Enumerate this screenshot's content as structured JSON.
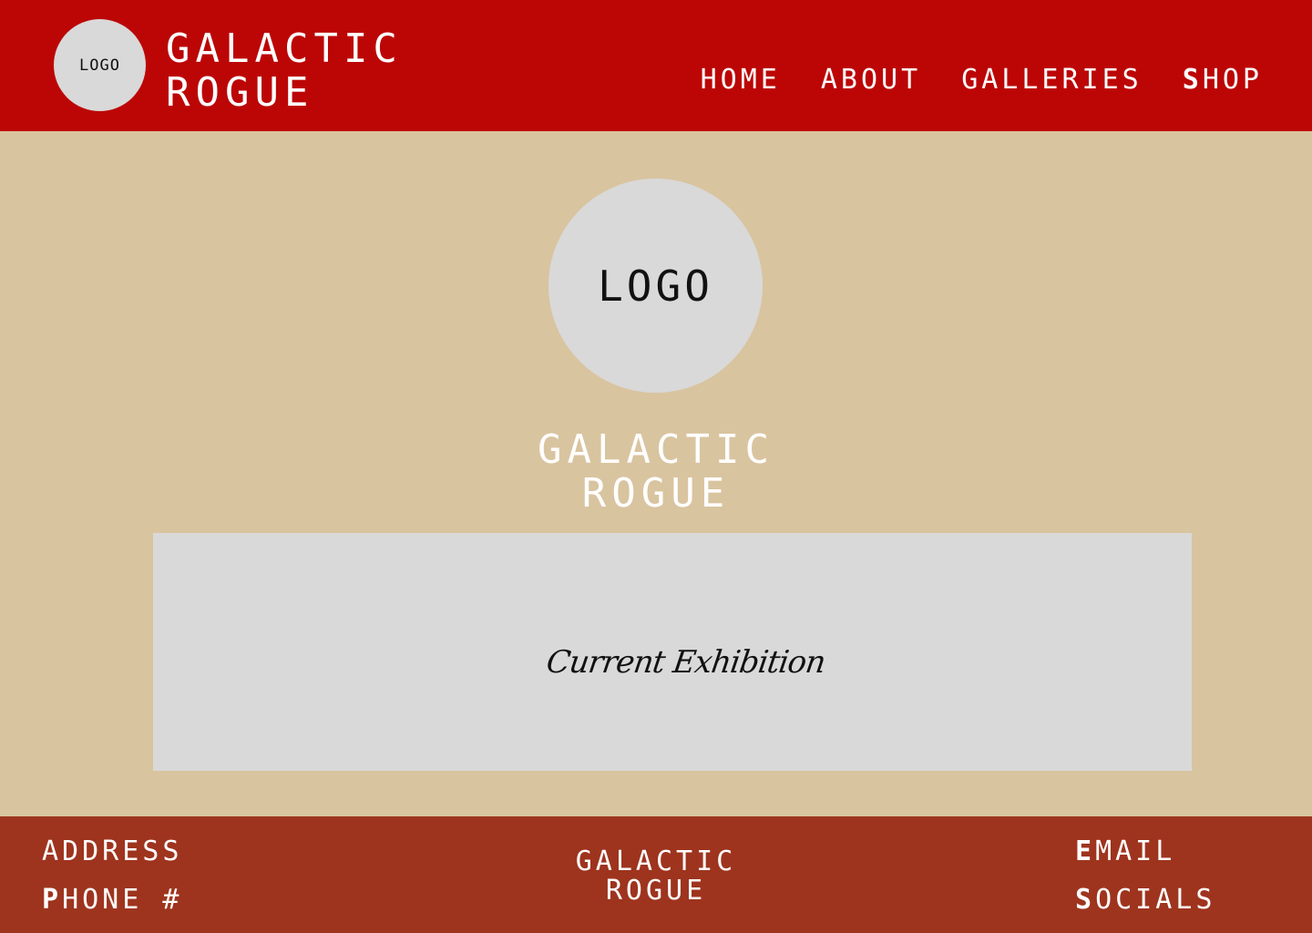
{
  "header": {
    "logo_text": "LOGO",
    "brand_line1": "GALACTIC",
    "brand_line2": "ROGUE",
    "nav": [
      {
        "label": "HOME"
      },
      {
        "label": "ABOUT"
      },
      {
        "label": "GALLERIES"
      },
      {
        "cap": "S",
        "rest": "HOP"
      }
    ],
    "background": "#bc0606"
  },
  "main": {
    "logo_text": "LOGO",
    "brand_line1": "GALACTIC",
    "brand_line2": "ROGUE",
    "exhibition_label": "Current Exhibition",
    "background": "#d9c4a0"
  },
  "footer": {
    "address": "ADDRESS",
    "phone_cap": "P",
    "phone_rest": "HONE #",
    "brand_line1": "GALACTIC",
    "brand_line2": "ROGUE",
    "email_cap": "E",
    "email_rest": "MAIL",
    "socials_cap": "S",
    "socials_rest": "OCIALS",
    "background": "#9e341e"
  }
}
